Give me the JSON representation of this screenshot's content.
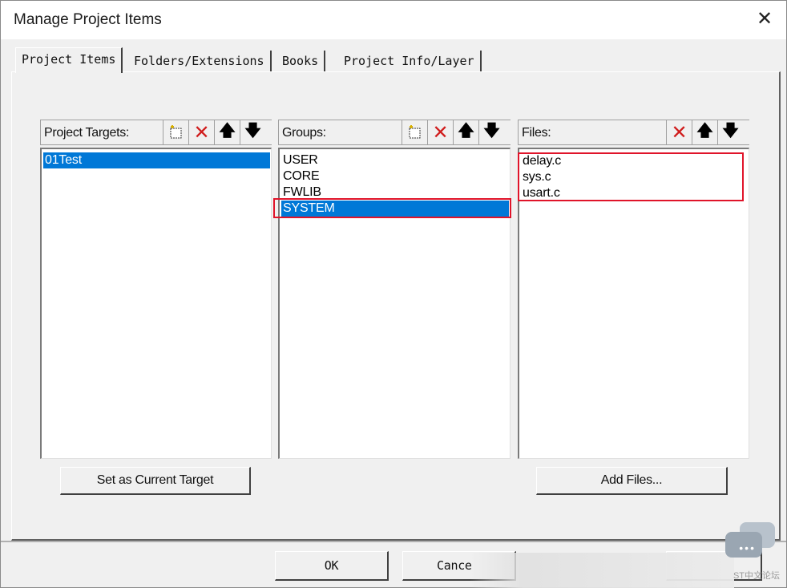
{
  "window": {
    "title": "Manage Project Items",
    "close_glyph": "✕"
  },
  "tabs": [
    {
      "label": "Project Items",
      "active": true
    },
    {
      "label": "Folders/Extensions",
      "active": false
    },
    {
      "label": "Books",
      "active": false
    },
    {
      "label": "Project Info/Layer",
      "active": false
    }
  ],
  "targets": {
    "label": "Project Targets:",
    "items": [
      "01Test"
    ],
    "selected": "01Test",
    "set_current_button": "Set as Current Target"
  },
  "groups": {
    "label": "Groups:",
    "items": [
      "USER",
      "CORE",
      "FWLIB",
      "SYSTEM"
    ],
    "selected": "SYSTEM"
  },
  "files": {
    "label": "Files:",
    "items": [
      "delay.c",
      "sys.c",
      "usart.c"
    ],
    "add_button": "Add Files..."
  },
  "toolbar_icons": {
    "new": "new-item-icon",
    "delete": "delete-icon",
    "up": "move-up-icon",
    "down": "move-down-icon"
  },
  "footer": {
    "ok": "OK",
    "cancel": "Cance",
    "watermark": "ST中文论坛"
  },
  "colors": {
    "selection": "#0078d7",
    "highlight_box": "#e0142a",
    "delete_icon": "#d01c1c"
  }
}
